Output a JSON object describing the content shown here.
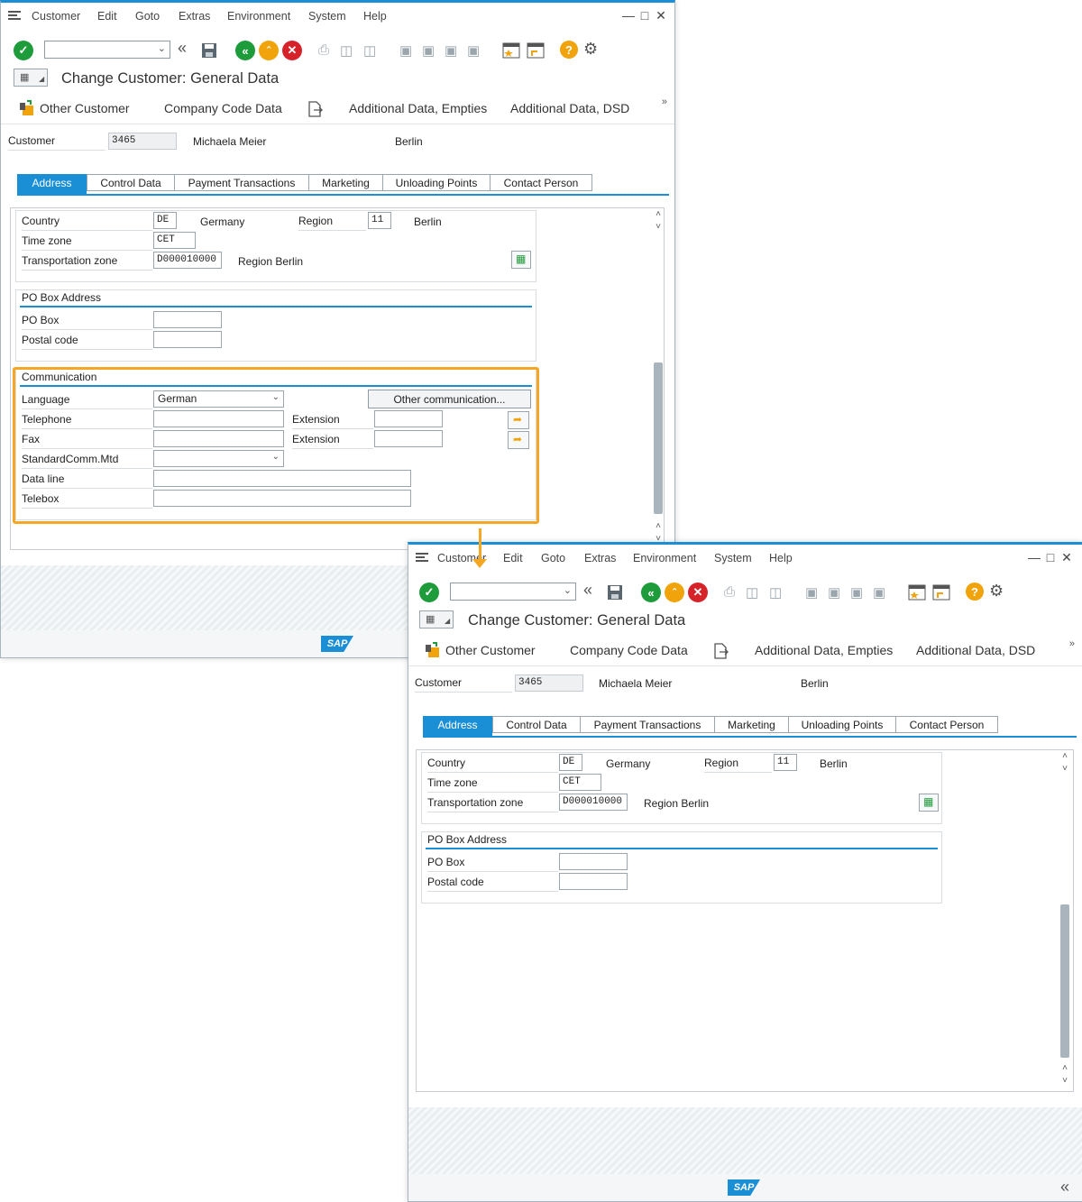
{
  "menu": {
    "items": [
      "Customer",
      "Edit",
      "Goto",
      "Extras",
      "Environment",
      "System",
      "Help"
    ]
  },
  "window": {
    "title": "Change Customer: General Data"
  },
  "app_toolbar": {
    "other_customer": "Other Customer",
    "company_code": "Company Code Data",
    "additional_empties": "Additional Data, Empties",
    "additional_dsd": "Additional Data, DSD"
  },
  "header": {
    "customer_label": "Customer",
    "customer_number": "3465",
    "customer_name": "Michaela Meier",
    "city": "Berlin"
  },
  "tabs": [
    "Address",
    "Control Data",
    "Payment Transactions",
    "Marketing",
    "Unloading Points",
    "Contact Person"
  ],
  "address": {
    "country_label": "Country",
    "country_code": "DE",
    "country_name": "Germany",
    "region_label": "Region",
    "region_code": "11",
    "region_name": "Berlin",
    "timezone_label": "Time zone",
    "timezone_value": "CET",
    "transport_label": "Transportation zone",
    "transport_value": "D000010000",
    "transport_desc": "Region Berlin"
  },
  "po_box": {
    "title": "PO Box Address",
    "po_box_label": "PO Box",
    "po_box_value": "",
    "postal_label": "Postal code",
    "postal_value": ""
  },
  "communication": {
    "title": "Communication",
    "language_label": "Language",
    "language_value": "German",
    "other_comm_button": "Other communication...",
    "telephone_label": "Telephone",
    "telephone_value": "",
    "extension_label": "Extension",
    "extension_value": "",
    "fax_label": "Fax",
    "fax_value": "",
    "fax_ext_label": "Extension",
    "fax_ext_value": "",
    "stdcomm_label": "StandardComm.Mtd",
    "stdcomm_value": "",
    "dataline_label": "Data line",
    "dataline_value": "",
    "telebox_label": "Telebox",
    "telebox_value": ""
  },
  "statusbar": {
    "logo": "SAP"
  },
  "colors": {
    "accent": "#1a8fd6",
    "highlight": "#f5a623",
    "ok_green": "#1e9b3a",
    "cancel_red": "#d6232a",
    "help_yellow": "#f0a30a"
  }
}
